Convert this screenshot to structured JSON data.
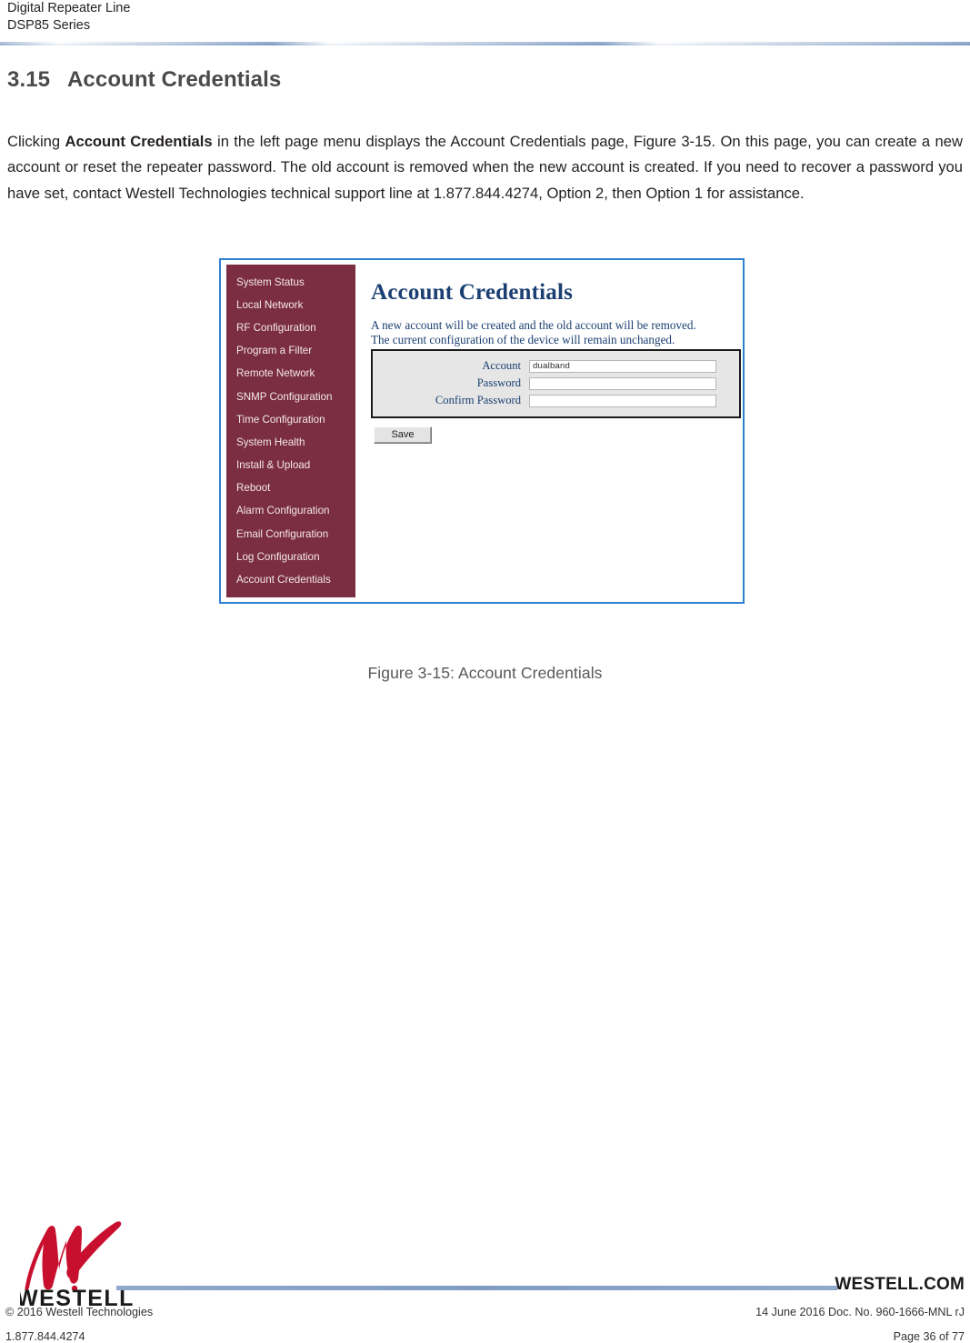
{
  "header": {
    "line1": "Digital Repeater Line",
    "line2": "DSP85 Series"
  },
  "section": {
    "number": "3.15",
    "title": "Account Credentials"
  },
  "paragraph": {
    "part1": "Clicking ",
    "bold": "Account Credentials",
    "part2": " in the left page menu displays the Account Credentials page, Figure 3-15. On this page, you can create a new account or reset the repeater password.  The old account is removed when the new account is created.  If you need to recover a password you have set, contact Westell Technologies technical support line at 1.877.844.4274, Option 2, then Option 1 for assistance."
  },
  "screenshot": {
    "sidebar": [
      {
        "label": "System Status"
      },
      {
        "label": "Local Network"
      },
      {
        "label": "RF Configuration"
      },
      {
        "label": "Program a Filter"
      },
      {
        "label": "Remote Network"
      },
      {
        "label": "SNMP Configuration"
      },
      {
        "label": "Time Configuration"
      },
      {
        "label": "System Health"
      },
      {
        "label": "Install & Upload"
      },
      {
        "label": "Reboot"
      },
      {
        "label": "Alarm Configuration"
      },
      {
        "label": "Email Configuration"
      },
      {
        "label": "Log Configuration"
      },
      {
        "label": "Account Credentials"
      }
    ],
    "page_title": "Account Credentials",
    "description_line1": "A new account will be created and the old account will be removed.",
    "description_line2": "The current configuration of the device will remain unchanged.",
    "fields": [
      {
        "label": "Account",
        "value": "dualband"
      },
      {
        "label": "Password",
        "value": ""
      },
      {
        "label": "Confirm Password",
        "value": ""
      }
    ],
    "save_label": "Save",
    "colors": {
      "sidebar_bg": "#7B2D42",
      "frame_border": "#2F7FD0",
      "title_blue": "#1B3F72",
      "panel_bg": "#E6E6E6"
    }
  },
  "figure": {
    "caption": "Figure 3-15: Account Credentials"
  },
  "footer": {
    "logo_wordmark": "WESTELL",
    "site": "WESTELL.COM",
    "copyright": "© 2016 Westell Technologies",
    "phone": "1.877.844.4274",
    "doc_info": "14 June 2016 Doc. No. 960-1666-MNL rJ",
    "page_info": "Page 36 of 77",
    "colors": {
      "rule_blue": "#7F9CC4",
      "logo_red": "#C8102E"
    }
  }
}
